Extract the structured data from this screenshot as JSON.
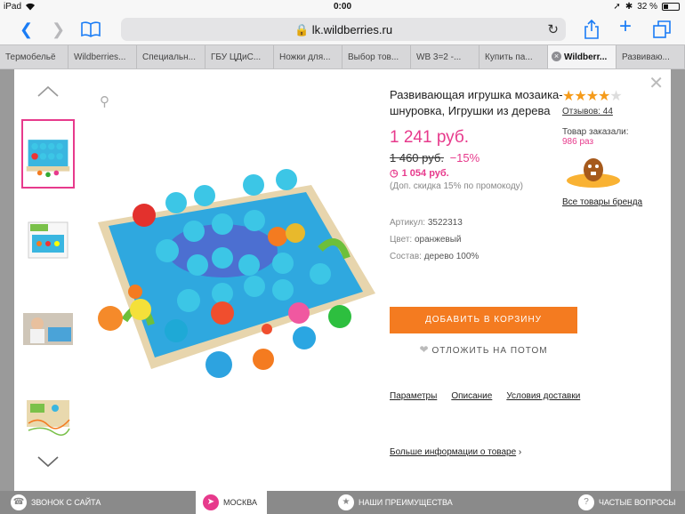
{
  "status_bar": {
    "device": "iPad",
    "time": "0:00",
    "battery": "32 %",
    "battery_level": 0.32
  },
  "browser": {
    "url": "lk.wildberries.ru"
  },
  "tabs": [
    {
      "label": "Термобельё"
    },
    {
      "label": "Wildberries..."
    },
    {
      "label": "Специальн..."
    },
    {
      "label": "ГБУ ЦДиС..."
    },
    {
      "label": "Ножки для..."
    },
    {
      "label": "Выбор тов..."
    },
    {
      "label": "WB 3=2 -..."
    },
    {
      "label": "Купить па..."
    },
    {
      "label": "Wildberr..."
    },
    {
      "label": "Развиваю..."
    }
  ],
  "product": {
    "title": "Развивающая игрушка мозаика-шнуровка, Игрушки из дерева",
    "price": "1 241 руб.",
    "old_price": "1 460 руб.",
    "discount": "−15%",
    "promo_price": "1 054 руб.",
    "promo_note": "(Доп. скидка 15% по промокоду)",
    "article_label": "Артикул:",
    "article_value": "3522313",
    "color_label": "Цвет:",
    "color_value": "оранжевый",
    "composition_label": "Состав:",
    "composition_value": "дерево 100%",
    "rating": 4,
    "rating_max": 5,
    "reviews": "Отзывов: 44",
    "ordered_label": "Товар заказали:",
    "ordered_count": "986 раз",
    "brand_link": "Все товары бренда",
    "add_to_cart": "ДОБАВИТЬ В КОРЗИНУ",
    "save_later": "ОТЛОЖИТЬ НА ПОТОМ",
    "sublinks": [
      "Параметры",
      "Описание",
      "Условия доставки"
    ],
    "more_info": "Больше информации о товаре"
  },
  "bottom_bar": {
    "call": "ЗВОНОК С САЙТА",
    "city": "МОСКВА",
    "advantages": "НАШИ ПРЕИМУЩЕСТВА",
    "faq": "ЧАСТЫЕ ВОПРОСЫ"
  },
  "colors": {
    "accent": "#e73a8c",
    "button": "#f47b20",
    "star": "#f59b1a",
    "link": "#1a7cf5"
  }
}
